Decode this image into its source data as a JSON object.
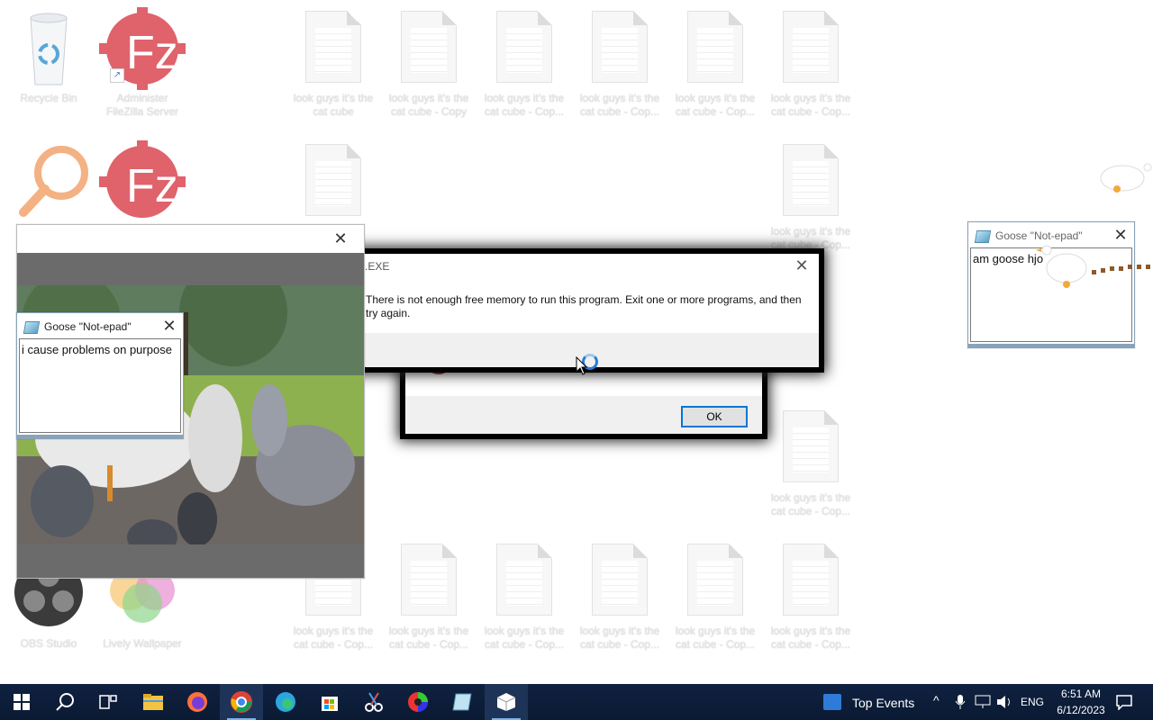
{
  "desktop_icons": [
    {
      "label": "Recycle Bin",
      "icon": "recycle-bin-icon"
    },
    {
      "label": "Administer FileZilla Server",
      "icon": "filezilla-icon"
    },
    {
      "label": "",
      "icon": "search-magnifier-icon"
    },
    {
      "label": "",
      "icon": "filezilla-icon"
    },
    {
      "label": "OBS Studio",
      "icon": "obs-icon"
    },
    {
      "label": "Lively Wallpaper",
      "icon": "lively-wallpaper-icon"
    }
  ],
  "file_icons": [
    {
      "label": "look guys it's the cat cube"
    },
    {
      "label": "look guys it's the cat cube - Copy"
    },
    {
      "label": "look guys it's the cat cube - Cop..."
    },
    {
      "label": "look guys it's the cat cube - Cop..."
    },
    {
      "label": "look guys it's the cat cube - Cop..."
    },
    {
      "label": "look guys it's the cat cube - Cop..."
    },
    {
      "label": "look guys it's the cat cube - Cop..."
    },
    {
      "label": "look guys it's the cat cube - Cop..."
    },
    {
      "label": "look guys it's the cat cube - Cop..."
    },
    {
      "label": "look guys it's the cat cube - Cop..."
    },
    {
      "label": "look guys it's the cat cube - Cop..."
    },
    {
      "label": "look guys it's the cat cube - Cop..."
    },
    {
      "label": "look guys it's the cat cube - Cop..."
    },
    {
      "label": "look guys it's the cat cube - Cop..."
    },
    {
      "label": "look guys it's the cat cube - Cop..."
    }
  ],
  "meme_window": {
    "title": ""
  },
  "notepad_left": {
    "title": "Goose \"Not-epad\"",
    "text": "i cause problems on purpose"
  },
  "notepad_right": {
    "title": "Goose \"Not-epad\"",
    "text": "am goose hjo"
  },
  "error_front": {
    "title": ".EXE",
    "message": "There is not enough free memory to run this program. Exit one or more programs, and then try again."
  },
  "error_back": {
    "message_fragment": "one or more programs, and then try again.",
    "ok_label": "OK"
  },
  "taskbar": {
    "apps": [
      "start-icon",
      "search-icon",
      "task-view-icon",
      "file-explorer-icon",
      "firefox-icon",
      "chrome-icon",
      "edge-icon",
      "store-icon",
      "snipping-icon",
      "color-icon",
      "notepad-icon",
      "box-icon"
    ],
    "widget_label": "Top Events",
    "language": "ENG",
    "time": "6:51 AM",
    "date": "6/12/2023"
  }
}
